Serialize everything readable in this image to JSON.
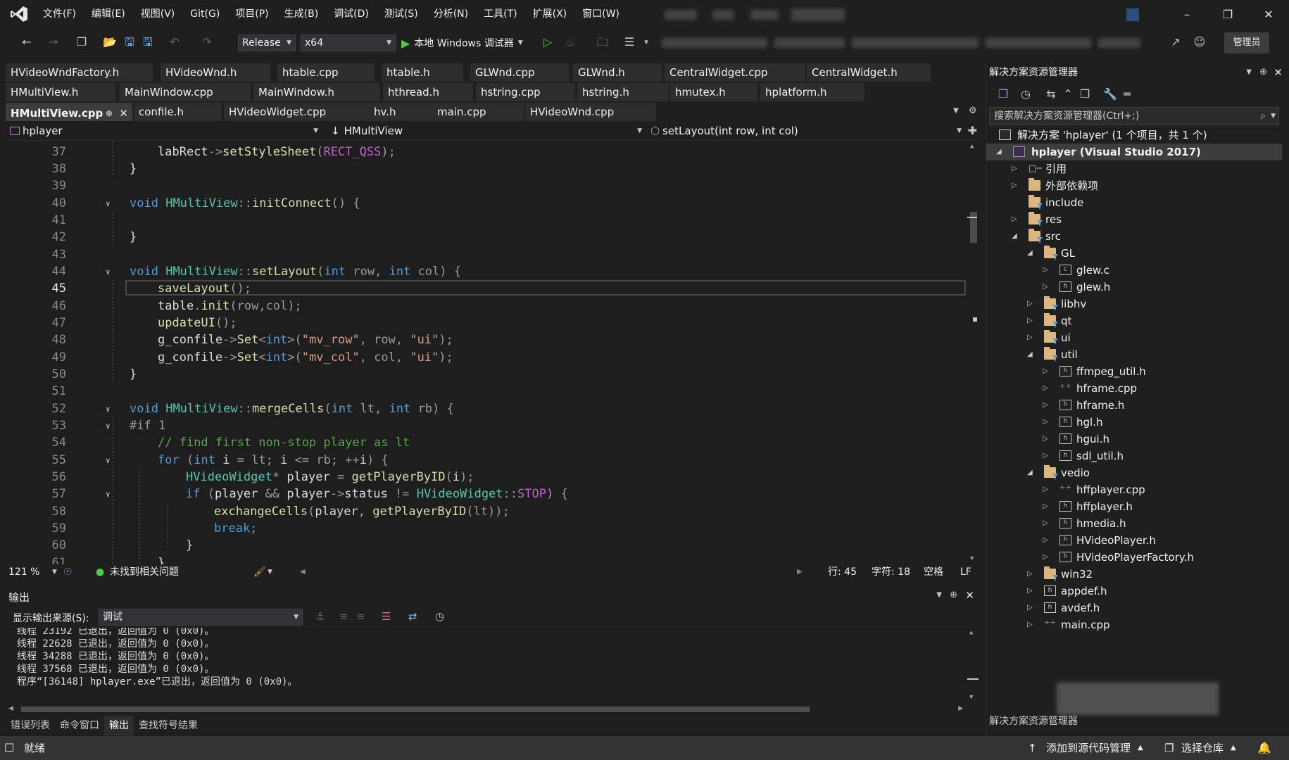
{
  "menu": {
    "items": [
      "文件(F)",
      "编辑(E)",
      "视图(V)",
      "Git(G)",
      "项目(P)",
      "生成(B)",
      "调试(D)",
      "测试(S)",
      "分析(N)",
      "工具(T)",
      "扩展(X)",
      "窗口(W)"
    ]
  },
  "toolbar": {
    "config": "Release",
    "platform": "x64",
    "run_label": "本地 Windows 调试器",
    "admin_label": "管理员"
  },
  "tabs": {
    "row1": [
      "HVideoWndFactory.h",
      "HVideoWnd.h",
      "htable.cpp",
      "htable.h",
      "GLWnd.cpp",
      "GLWnd.h",
      "CentralWidget.cpp",
      "CentralWidget.h"
    ],
    "row2": [
      "HMultiView.h",
      "MainWindow.cpp",
      "MainWindow.h",
      "hthread.h",
      "hstring.cpp",
      "hstring.h",
      "hmutex.h",
      "hplatform.h"
    ],
    "row3": [
      "HMultiView.cpp",
      "confile.h",
      "HVideoWidget.cpp",
      "hv.h",
      "main.cpp",
      "HVideoWnd.cpp"
    ]
  },
  "nav": {
    "project": "hplayer",
    "class": "HMultiView",
    "member": "setLayout(int row, int col)"
  },
  "editor": {
    "line_numbers": [
      "37",
      "38",
      "39",
      "40",
      "41",
      "42",
      "43",
      "44",
      "45",
      "46",
      "47",
      "48",
      "49",
      "50",
      "51",
      "52",
      "53",
      "54",
      "55",
      "56",
      "57",
      "58",
      "59",
      "60",
      "61"
    ],
    "current_line": "45",
    "code": {
      "l37": "labRect->setStyleSheet(RECT_QSS);",
      "l38": "}",
      "l40": "void HMultiView::initConnect() {",
      "l42": "}",
      "l44": "void HMultiView::setLayout(int row, int col) {",
      "l45": "saveLayout();",
      "l46": "table.init(row,col);",
      "l47": "updateUI();",
      "l48": "g_confile->Set<int>(\"mv_row\", row, \"ui\");",
      "l49": "g_confile->Set<int>(\"mv_col\", col, \"ui\");",
      "l50": "}",
      "l52": "void HMultiView::mergeCells(int lt, int rb) {",
      "l53": "#if 1",
      "l54": "// find first non-stop player as lt",
      "l55": "for (int i = lt; i <= rb; ++i) {",
      "l56": "HVideoWidget* player = getPlayerByID(i);",
      "l57": "if (player && player->status != HVideoWidget::STOP) {",
      "l58": "exchangeCells(player, getPlayerByID(lt));",
      "l59": "break;",
      "l60": "}",
      "l61": "}"
    }
  },
  "edstatus": {
    "zoom": "121 %",
    "issues": "未找到相关问题",
    "line": "行: 45",
    "char": "字符: 18",
    "indent": "空格",
    "eol": "LF"
  },
  "output": {
    "title": "输出",
    "source_label": "显示输出来源(S):",
    "source_value": "调试",
    "lines": [
      "线程 23192 已退出，返回值为 0 (0x0)。",
      "线程 22628 已退出，返回值为 0 (0x0)。",
      "线程 34288 已退出，返回值为 0 (0x0)。",
      "线程 37568 已退出，返回值为 0 (0x0)。",
      "程序“[36148] hplayer.exe”已退出，返回值为 0 (0x0)。"
    ],
    "tabs": [
      "错误列表",
      "命令窗口",
      "输出",
      "查找符号结果"
    ]
  },
  "solution": {
    "title": "解决方案资源管理器",
    "search_placeholder": "搜索解决方案资源管理器(Ctrl+;)",
    "solution_label": "解决方案 'hplayer' (1 个项目，共 1 个)",
    "project_label": "hplayer (Visual Studio 2017)",
    "nodes": [
      "引用",
      "外部依赖项",
      "include",
      "res",
      "src",
      "GL",
      "glew.c",
      "glew.h",
      "libhv",
      "qt",
      "ui",
      "util",
      "ffmpeg_util.h",
      "hframe.cpp",
      "hframe.h",
      "hgl.h",
      "hgui.h",
      "sdl_util.h",
      "vedio",
      "hffplayer.cpp",
      "hffplayer.h",
      "hmedia.h",
      "HVideoPlayer.h",
      "HVideoPlayerFactory.h",
      "win32",
      "appdef.h",
      "avdef.h",
      "main.cpp"
    ],
    "bottom_tab": "解决方案资源管理器"
  },
  "statusbar": {
    "ready": "就绪",
    "source_control": "添加到源代码管理",
    "repo": "选择仓库"
  },
  "colors": {
    "accent": "#569cd6",
    "type": "#4ec9b0",
    "function": "#dcdcaa",
    "macro": "#bd63c5",
    "string": "#d69d85",
    "comment": "#57a64a",
    "run_green": "#4ec94e"
  }
}
